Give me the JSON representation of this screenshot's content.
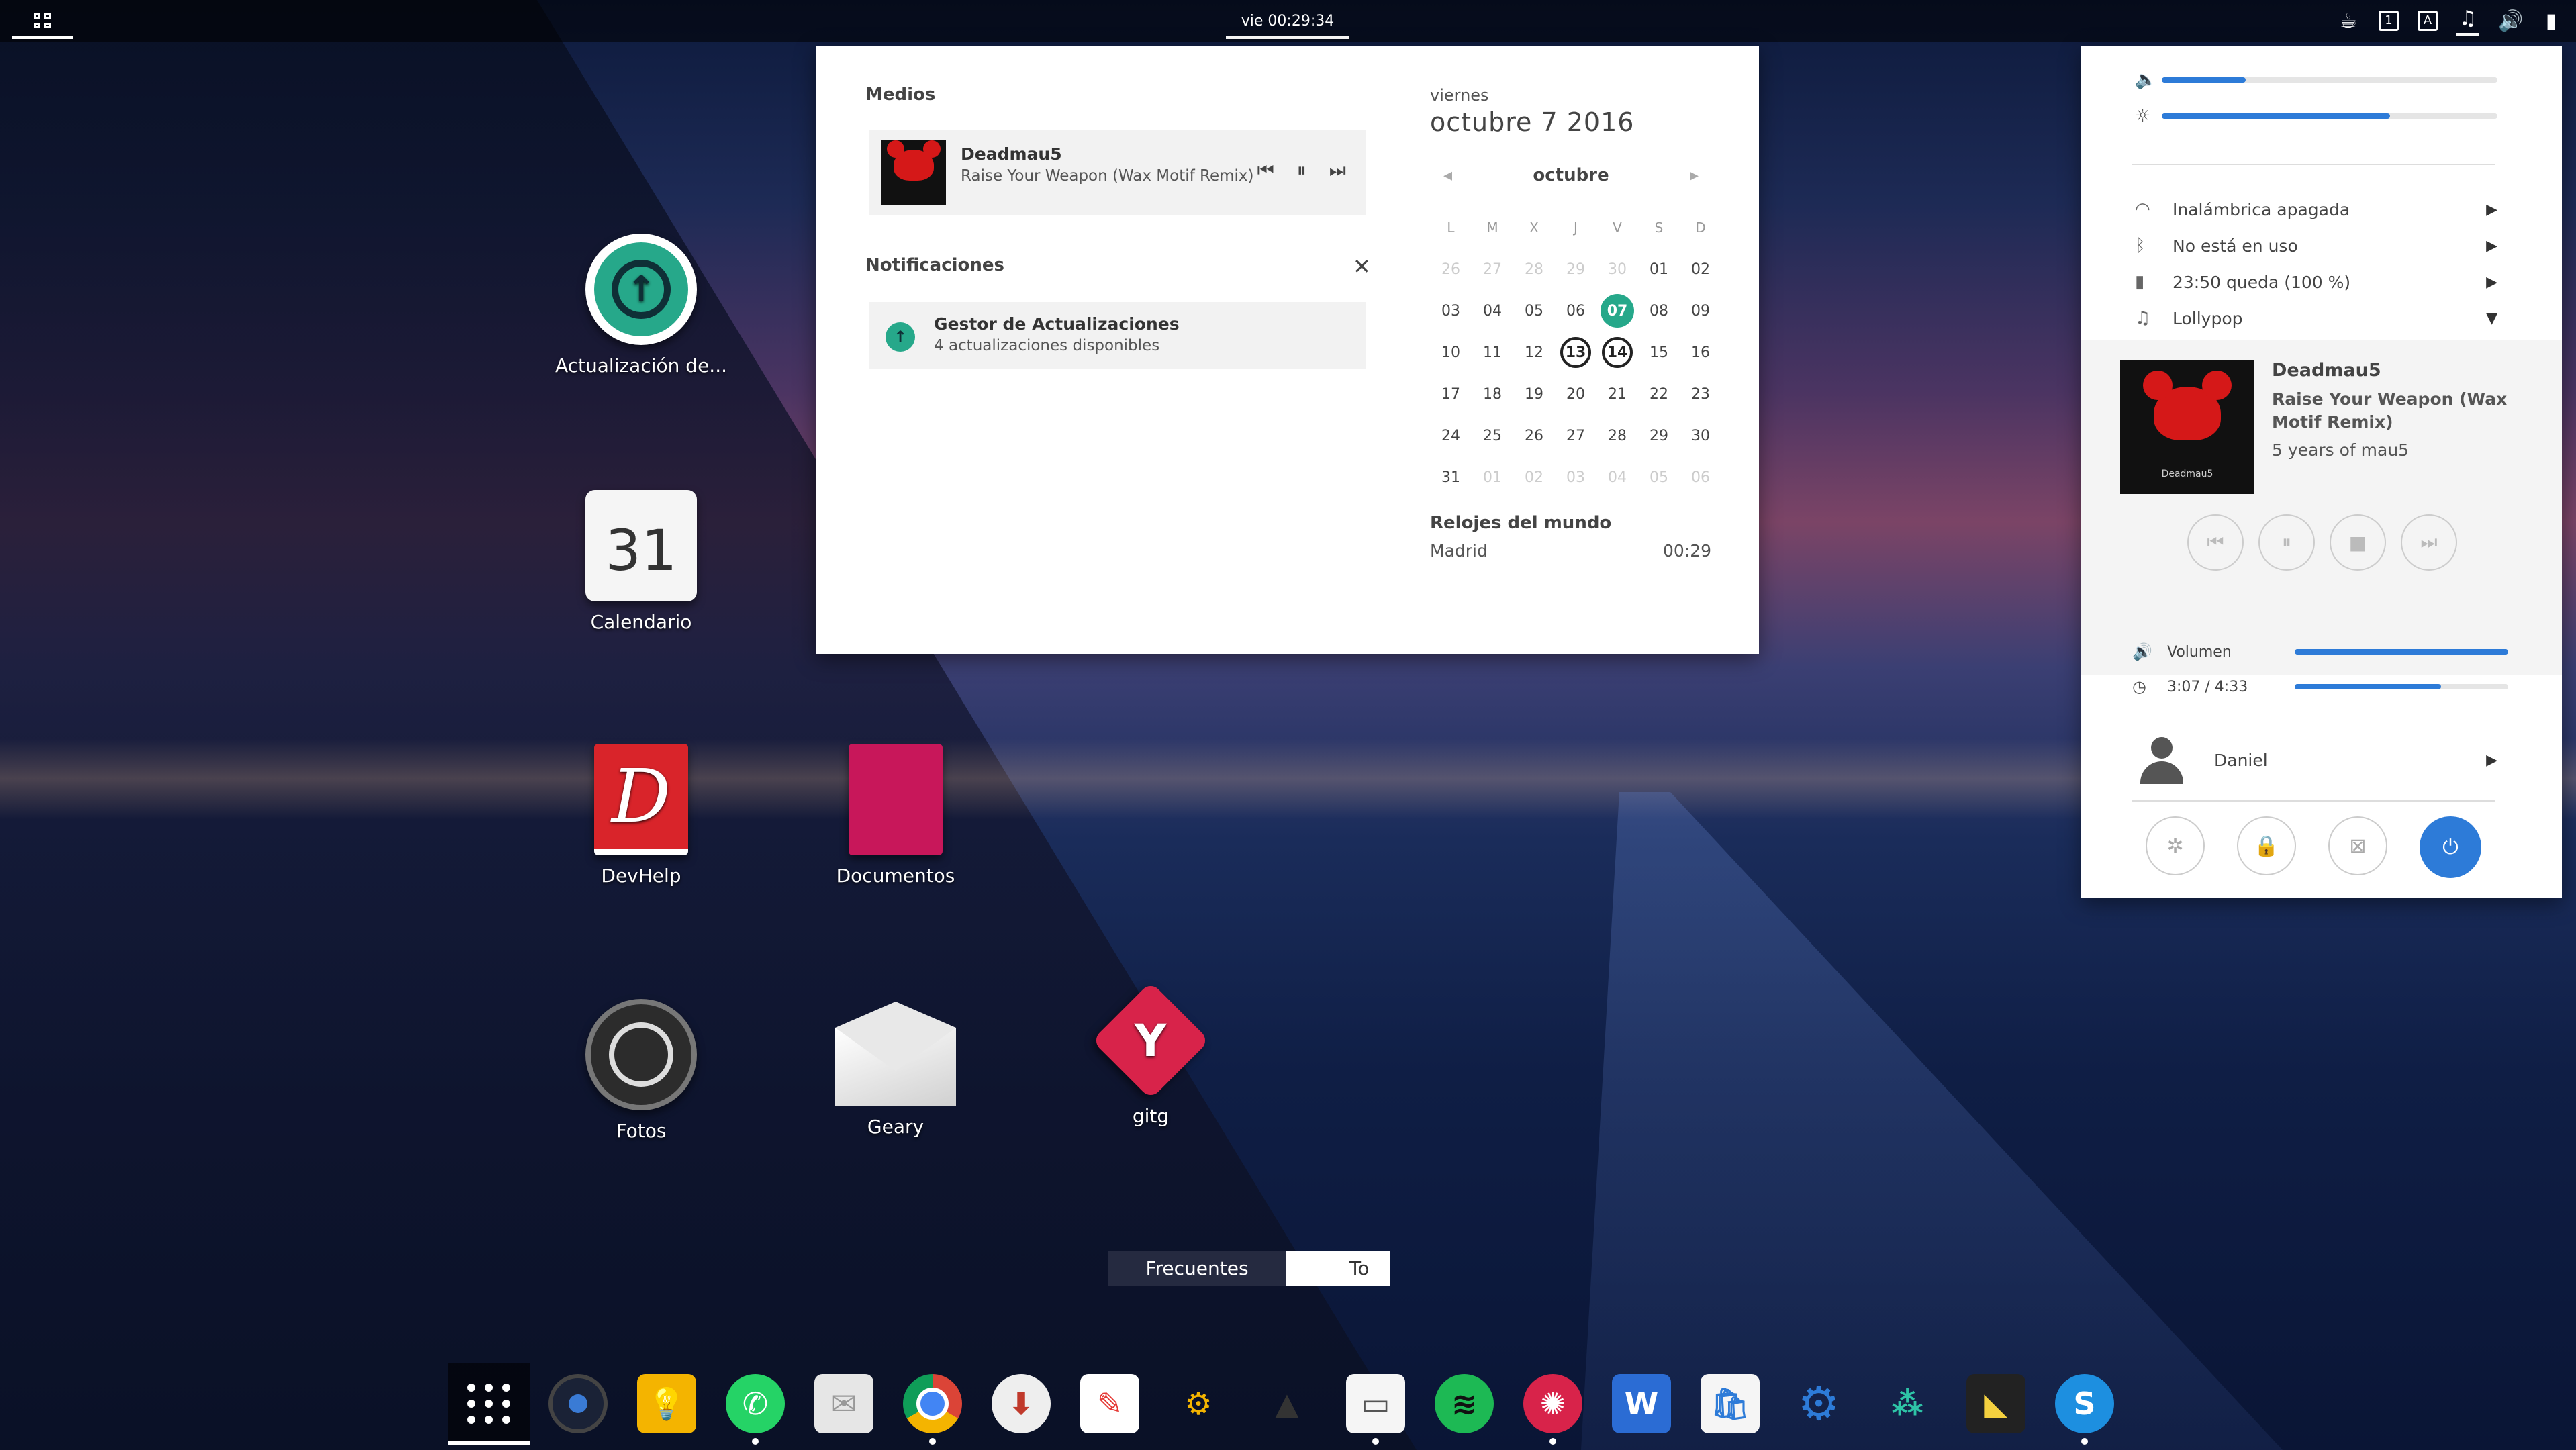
{
  "topbar": {
    "clock": "vie 00:29:34",
    "tray_icons": [
      "coffee-icon",
      "workspace-1-icon",
      "keyboard-a-icon",
      "music-icon",
      "volume-icon",
      "battery-icon"
    ],
    "workspace_label": "1",
    "keyboard_label": "A"
  },
  "desktop": {
    "icons": [
      {
        "label": "Actualización de...",
        "icon": "update-icon"
      },
      {
        "label": "Calendario",
        "icon": "calendar-icon",
        "day": "31"
      },
      {
        "label": "DevHelp",
        "icon": "devhelp-icon",
        "glyph": "D"
      },
      {
        "label": "Documentos",
        "icon": "documents-icon"
      },
      {
        "label": "Fotos",
        "icon": "photos-icon"
      },
      {
        "label": "Geary",
        "icon": "mail-icon"
      },
      {
        "label": "gitg",
        "icon": "git-icon"
      }
    ],
    "tabs": {
      "frequent": "Frecuentes",
      "all": "To"
    }
  },
  "popover": {
    "media_title": "Medios",
    "media": {
      "artist": "Deadmau5",
      "song": "Raise Your Weapon (Wax Motif Remix)"
    },
    "notifications_title": "Notificaciones",
    "notification": {
      "title": "Gestor de Actualizaciones",
      "body": "4 actualizaciones disponibles"
    },
    "calendar": {
      "weekday": "viernes",
      "date": "octubre  7 2016",
      "month": "octubre",
      "headers": [
        "L",
        "M",
        "X",
        "J",
        "V",
        "S",
        "D"
      ],
      "weeks": [
        [
          "26",
          "27",
          "28",
          "29",
          "30",
          "01",
          "02"
        ],
        [
          "03",
          "04",
          "05",
          "06",
          "07",
          "08",
          "09"
        ],
        [
          "10",
          "11",
          "12",
          "13",
          "14",
          "15",
          "16"
        ],
        [
          "17",
          "18",
          "19",
          "20",
          "21",
          "22",
          "23"
        ],
        [
          "24",
          "25",
          "26",
          "27",
          "28",
          "29",
          "30"
        ],
        [
          "31",
          "01",
          "02",
          "03",
          "04",
          "05",
          "06"
        ]
      ],
      "today": "07",
      "marked": [
        "13",
        "14"
      ]
    },
    "world_clocks_title": "Relojes del mundo",
    "world_clock": {
      "city": "Madrid",
      "time": "00:29"
    }
  },
  "panel": {
    "volume_level": 0.25,
    "brightness_level": 0.68,
    "wireless": "Inalámbrica apagada",
    "bluetooth": "No está en uso",
    "battery": "23:50 queda (100 %)",
    "player_app": "Lollypop",
    "player": {
      "artist": "Deadmau5",
      "song": "Raise Your Weapon (Wax Motif Remix)",
      "album": "5 years of mau5",
      "volume_label": "Volumen",
      "volume_level": 1.0,
      "position": "3:07 / 4:33",
      "progress": 0.685
    },
    "user": "Daniel"
  },
  "dock": {
    "apps": [
      "app-grid-icon",
      "camera-icon",
      "ideas-icon",
      "whatsapp-icon",
      "mail-icon",
      "chrome-icon",
      "installer-icon",
      "document-edit-icon",
      "robot-arm-icon",
      "inkscape-icon",
      "files-icon",
      "spotify-icon",
      "media-player-icon",
      "word-icon",
      "store-icon",
      "settings-icon",
      "network-icon",
      "monitor-icon",
      "skype-icon"
    ]
  }
}
